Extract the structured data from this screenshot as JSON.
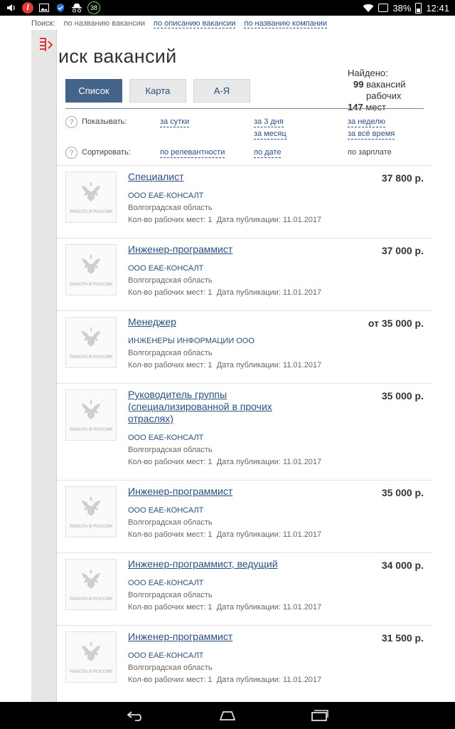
{
  "status_bar": {
    "badge_count": "38",
    "battery": "38%",
    "time": "12:41"
  },
  "search": {
    "label": "Поиск:",
    "options": [
      "по названию вакансии",
      "по описанию вакансии",
      "по названию компании"
    ]
  },
  "page": {
    "title": "иск вакансий",
    "tabs": [
      "Список",
      "Карта",
      "А-Я"
    ],
    "found_label": "Найдено:",
    "found_vacancies_count": "99",
    "found_vacancies_label": "вакансий",
    "found_places_label_1": "рабочих",
    "found_places_count": "147",
    "found_places_label_2": "мест"
  },
  "filters": {
    "show_label": "Показывать:",
    "show_options": [
      "за сутки",
      "за 3 дня",
      "за неделю",
      "за месяц",
      "за всё время"
    ],
    "sort_label": "Сортировать:",
    "sort_options": [
      "по релевантности",
      "по дате",
      "по зарплате"
    ],
    "help_mark": "?"
  },
  "logo_text": "РАБОТА В РОССИИ",
  "vacancies": [
    {
      "title": "Специалист",
      "price": "37 800 р.",
      "company": "ООО ЕАЕ-КОНСАЛТ",
      "region": "Волгоградская область",
      "places": "Кол-во рабочих мест: 1",
      "date": "Дата публикации: 11.01.2017"
    },
    {
      "title": "Инженер-программист",
      "price": "37 000 р.",
      "company": "ООО ЕАЕ-КОНСАЛТ",
      "region": "Волгоградская область",
      "places": "Кол-во рабочих мест: 1",
      "date": "Дата публикации: 11.01.2017"
    },
    {
      "title": "Менеджер",
      "price": "от 35 000 р.",
      "company": "ИНЖЕНЕРЫ ИНФОРМАЦИИ ООО",
      "region": "Волгоградская область",
      "places": "Кол-во рабочих мест: 1",
      "date": "Дата публикации: 11.01.2017"
    },
    {
      "title": "Руководитель группы (специализированной в прочих отраслях)",
      "price": "35 000 р.",
      "company": "ООО ЕАЕ-КОНСАЛТ",
      "region": "Волгоградская область",
      "places": "Кол-во рабочих мест: 1",
      "date": "Дата публикации: 11.01.2017"
    },
    {
      "title": "Инженер-программист",
      "price": "35 000 р.",
      "company": "ООО ЕАЕ-КОНСАЛТ",
      "region": "Волгоградская область",
      "places": "Кол-во рабочих мест: 1",
      "date": "Дата публикации: 11.01.2017"
    },
    {
      "title": "Инженер-программист, ведущий",
      "price": "34 000 р.",
      "company": "ООО ЕАЕ-КОНСАЛТ",
      "region": "Волгоградская область",
      "places": "Кол-во рабочих мест: 1",
      "date": "Дата публикации: 11.01.2017"
    },
    {
      "title": "Инженер-программист",
      "price": "31 500 р.",
      "company": "ООО ЕАЕ-КОНСАЛТ",
      "region": "Волгоградская область",
      "places": "Кол-во рабочих мест: 1",
      "date": "Дата публикации: 11.01.2017"
    }
  ]
}
